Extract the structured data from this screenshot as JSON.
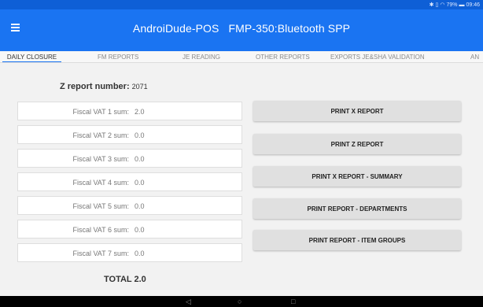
{
  "status_bar": {
    "icons": [
      "bluetooth-icon",
      "vibrate-icon",
      "wifi-icon"
    ],
    "battery": "79%",
    "time": "09:46"
  },
  "app_bar": {
    "title": "AndroiDude-POS",
    "device": "FMP-350:Bluetooth SPP",
    "color": "#1a74f2"
  },
  "tabs": [
    {
      "label": "DAILY CLOSURE",
      "active": true
    },
    {
      "label": "FM REPORTS",
      "active": false
    },
    {
      "label": "JE READING",
      "active": false
    },
    {
      "label": "OTHER REPORTS",
      "active": false
    },
    {
      "label": "EXPORTS JE&SHA VALIDATION",
      "active": false
    },
    {
      "label": "AN",
      "active": false
    }
  ],
  "zreport": {
    "label": "Z report number:",
    "value": "2071"
  },
  "vat_rows": [
    {
      "label": "Fiscal VAT 1 sum:",
      "value": "2.0"
    },
    {
      "label": "Fiscal VAT 2 sum:",
      "value": "0.0"
    },
    {
      "label": "Fiscal VAT 3 sum:",
      "value": "0.0"
    },
    {
      "label": "Fiscal VAT 4 sum:",
      "value": "0.0"
    },
    {
      "label": "Fiscal VAT 5 sum:",
      "value": "0.0"
    },
    {
      "label": "Fiscal VAT 6 sum:",
      "value": "0.0"
    },
    {
      "label": "Fiscal VAT 7 sum:",
      "value": "0.0"
    }
  ],
  "total": "TOTAL 2.0",
  "buttons": [
    {
      "label": "PRINT X REPORT"
    },
    {
      "label": "PRINT Z REPORT"
    },
    {
      "label": "PRINT X REPORT - SUMMARY"
    },
    {
      "label": "PRINT REPORT - DEPARTMENTS"
    },
    {
      "label": "PRINT REPORT - ITEM GROUPS"
    }
  ],
  "nav_bar": {
    "back": "◁",
    "home": "○",
    "recents": "□"
  }
}
